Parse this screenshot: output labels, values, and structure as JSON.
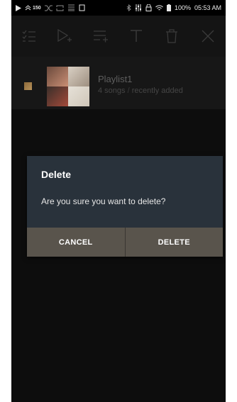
{
  "status_bar": {
    "left_icons": [
      "play-icon",
      "hires-icon",
      "shuffle-icon",
      "repeat-icon",
      "equalizer-icon",
      "copy-icon"
    ],
    "hires_label": "150",
    "right_icons": [
      "bluetooth-icon",
      "eq-sliders-icon",
      "lock-icon",
      "wifi-icon",
      "battery-icon"
    ],
    "battery_percent": "100%",
    "time": "05:53 AM"
  },
  "toolbar": {
    "buttons": [
      "select-all-icon",
      "play-add-icon",
      "add-to-queue-icon",
      "rename-icon",
      "delete-icon",
      "close-icon"
    ]
  },
  "playlist": {
    "title": "Playlist1",
    "count": "4 songs",
    "separator": "/",
    "sort": "recently added"
  },
  "dialog": {
    "title": "Delete",
    "message": "Are you sure you want to delete?",
    "cancel_label": "CANCEL",
    "delete_label": "DELETE"
  },
  "colors": {
    "background": "#0d0d0d",
    "dialog_bg": "#29323b",
    "dialog_button_bg": "#59544c",
    "text_primary": "#ffffff"
  }
}
